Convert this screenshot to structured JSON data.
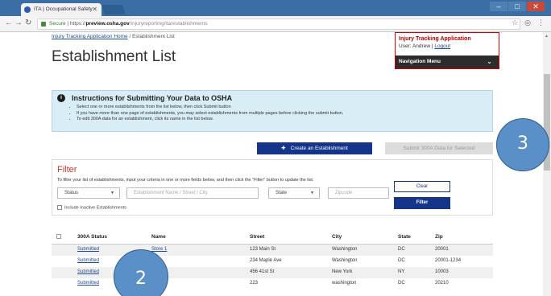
{
  "browser": {
    "tab_title": "ITA | Occupational Safety",
    "secure_label": "Secure",
    "url_scheme": "https://",
    "url_host": "preview.osha.gov",
    "url_path": "/injuryreporting/ita/establishments"
  },
  "breadcrumb": {
    "home": "Injury Tracking Application Home",
    "separator": "/",
    "current": "Establishment List"
  },
  "page_title": "Establishment List",
  "app_panel": {
    "title": "Injury Tracking Application",
    "user_label": "User: Andrew |",
    "logout": "Logout",
    "nav_menu": "Navigation Menu"
  },
  "instructions": {
    "title": "Instructions for Submitting Your Data to OSHA",
    "items": [
      "Select one or more establishments from the list below, then click Submit button",
      "If you have more than one page of establishments, you may select establishments from multiple pages before clicking the submit button.",
      "To edit 300A data for an establishment, click its name in the list below."
    ]
  },
  "actions": {
    "create": "Create an Establishment",
    "submit": "Submit 300A Data for Selected"
  },
  "filter": {
    "title": "Filter",
    "help": "To filter your list of establishments, input your criteria in one or more fields below, and then click the \"Filter\" button to update the list.",
    "status_value": "Status",
    "name_placeholder": "Establishment Name / Street / City",
    "state_value": "State",
    "zip_placeholder": "Zipcode",
    "include_inactive": "Include Inactive Establishments",
    "clear": "Clear",
    "apply": "Filter"
  },
  "table": {
    "headers": {
      "status": "300A Status",
      "name": "Name",
      "street": "Street",
      "city": "City",
      "state": "State",
      "zip": "Zip"
    },
    "rows": [
      {
        "status": "Submitted",
        "name": "Store 1",
        "street": "123 Main St",
        "city": "Washington",
        "state": "DC",
        "zip": "20001"
      },
      {
        "status": "Submitted",
        "name": "",
        "street": "234 Maple Ave",
        "city": "Washington",
        "state": "DC",
        "zip": "20001-1234"
      },
      {
        "status": "Submitted",
        "name": "",
        "street": "456 41st St",
        "city": "New York",
        "state": "NY",
        "zip": "10003"
      },
      {
        "status": "Submitted",
        "name": "",
        "street": "223",
        "city": "washington",
        "state": "DC",
        "zip": "20210"
      }
    ]
  },
  "callouts": {
    "three": "3",
    "two": "2"
  },
  "colors": {
    "primary_button": "#14358a",
    "filter_title": "#c0392b",
    "app_panel_border": "#cc0000",
    "callout_fill": "#5b8fc7",
    "instructions_bg": "#d9edf7"
  }
}
